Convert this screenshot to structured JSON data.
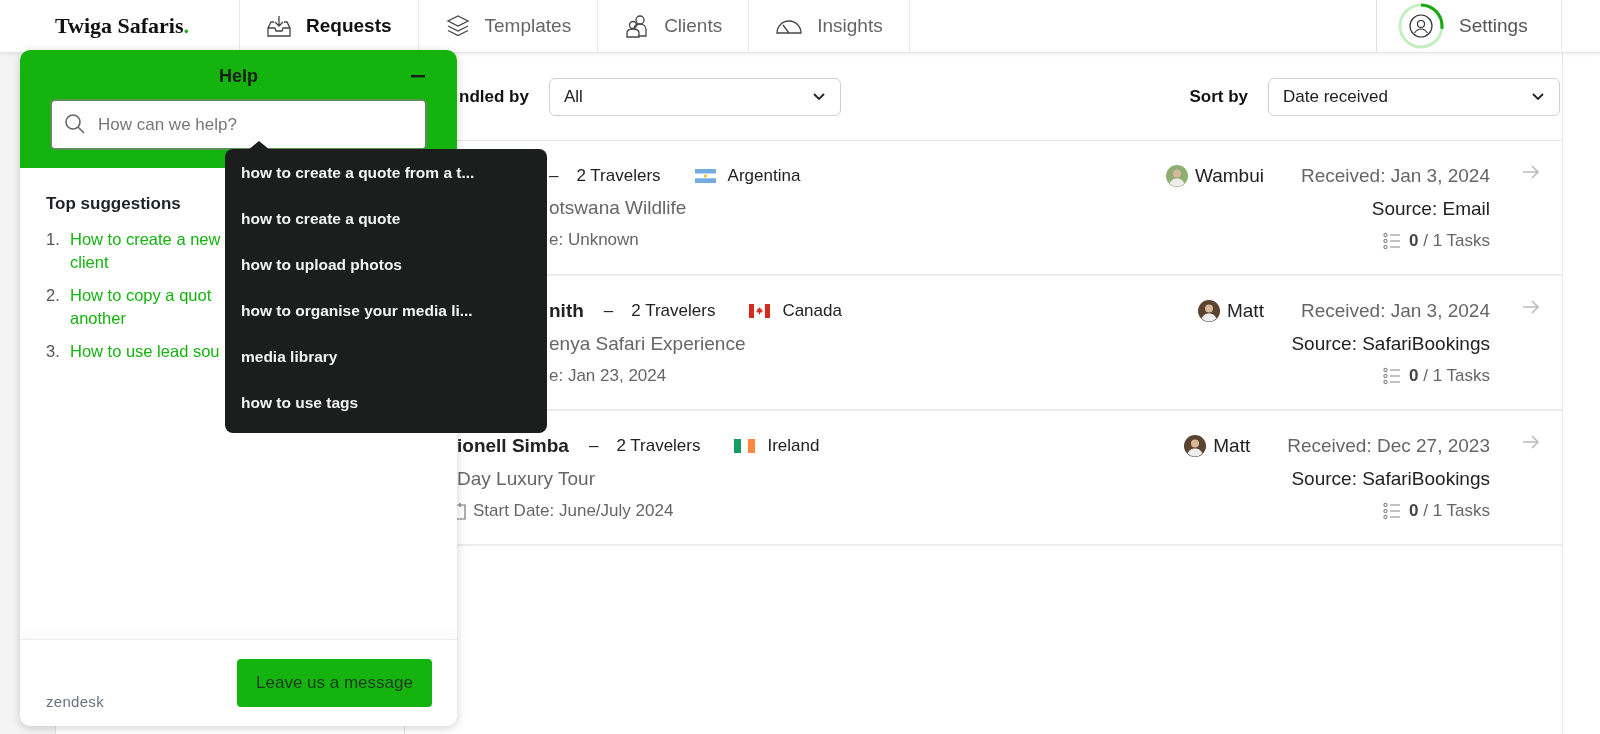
{
  "logo": {
    "name": "Twiga Safaris",
    "mark": "."
  },
  "tabs": [
    {
      "label": "Requests",
      "selected": true
    },
    {
      "label": "Templates",
      "selected": false
    },
    {
      "label": "Clients",
      "selected": false
    },
    {
      "label": "Insights",
      "selected": false
    }
  ],
  "settings": {
    "label": "Settings",
    "level": 0.27
  },
  "filters": {
    "handled_by": {
      "label": "ndled by",
      "value": "All"
    },
    "sort_by": {
      "label": "Sort by",
      "value": "Date received"
    }
  },
  "requests": [
    {
      "separator": "–",
      "travelers": "2 Travelers",
      "country": "Argentina",
      "trip": "otswana Wildlife",
      "start": "e: Unknown",
      "calendar_icon": false,
      "agent": "Wambui",
      "received": "Received: Jan 3, 2024",
      "source": "Source: Email",
      "tasks_done": "0",
      "tasks_total": "/ 1 Tasks"
    },
    {
      "client": "nith",
      "separator": "–",
      "travelers": "2 Travelers",
      "country": "Canada",
      "trip": "enya Safari Experience",
      "start": "e: Jan 23, 2024",
      "calendar_icon": false,
      "agent": "Matt",
      "received": "Received: Jan 3, 2024",
      "source": "Source: SafariBookings",
      "tasks_done": "0",
      "tasks_total": "/ 1 Tasks"
    },
    {
      "client": "ionell Simba",
      "separator": "–",
      "travelers": "2 Travelers",
      "country": "Ireland",
      "trip": "Day Luxury Tour",
      "start": "Start Date: June/July 2024",
      "calendar_icon": true,
      "agent": "Matt",
      "received": "Received: Dec 27, 2023",
      "source": "Source: SafariBookings",
      "tasks_done": "0",
      "tasks_total": "/ 1 Tasks"
    }
  ],
  "help": {
    "title": "Help",
    "search": {
      "placeholder": "How can we help?"
    },
    "suggestions_dropdown": [
      "how to create a quote from a t...",
      "how to create a quote",
      "how to upload photos",
      "how to organise your media li...",
      "media library",
      "how to use tags"
    ],
    "top_suggestions": {
      "heading": "Top suggestions",
      "items": [
        {
          "number": "1.",
          "lines": [
            "How to create a new",
            "client"
          ]
        },
        {
          "number": "2.",
          "lines": [
            "How to copy a quot",
            "another"
          ]
        },
        {
          "number": "3.",
          "lines": [
            "How to use lead sou"
          ]
        }
      ]
    },
    "brand": "zendesk",
    "button": "Leave us a message"
  }
}
